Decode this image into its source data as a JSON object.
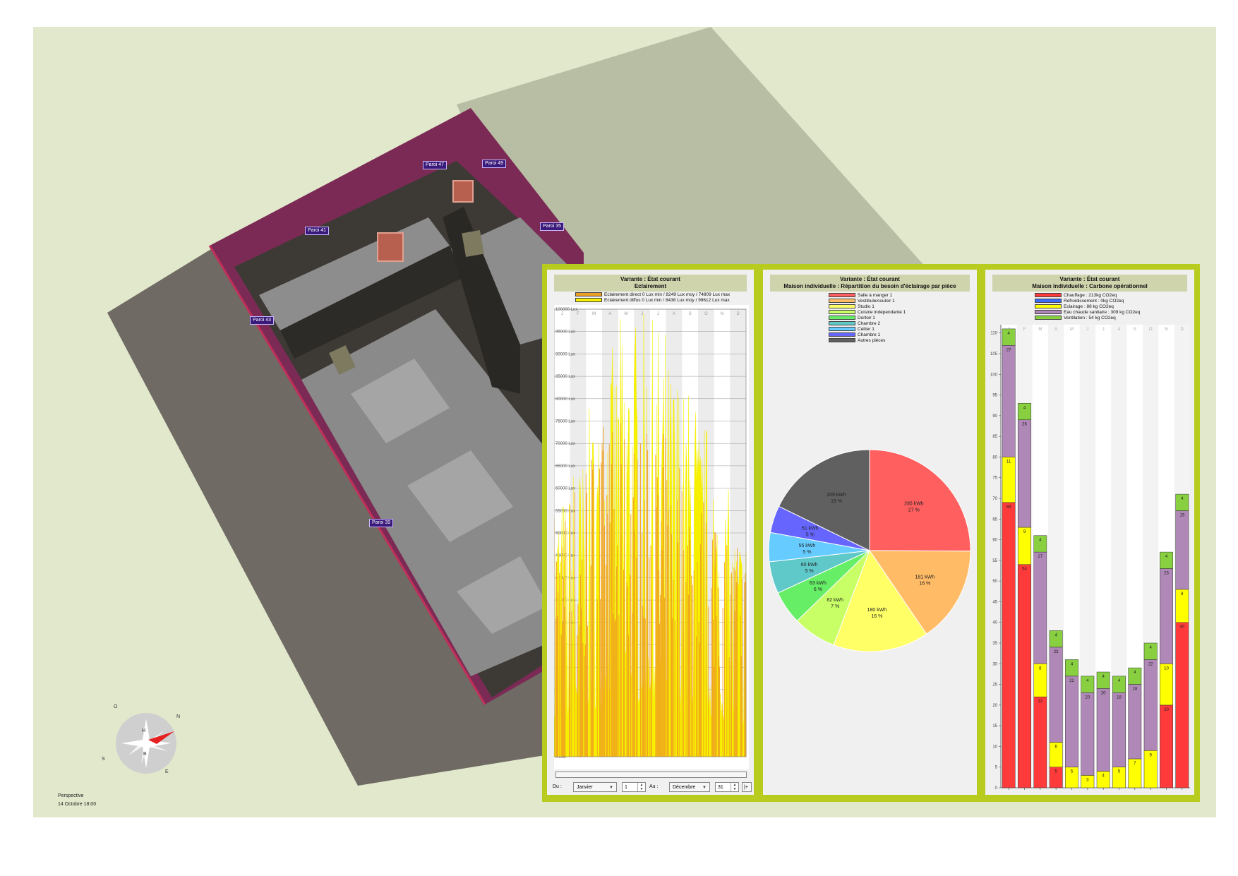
{
  "viewport": {
    "view_mode": "Perspective",
    "datetime": "14 Octobre 18:00",
    "wall_tags": [
      "Paroi 41",
      "Paroi 47",
      "Paroi 49",
      "Paroi 35",
      "Paroi 43",
      "Paroi 39"
    ],
    "compass": {
      "n": "N",
      "s": "S",
      "e": "E",
      "o": "O",
      "h": "H",
      "b": "B"
    }
  },
  "colors": {
    "frame": "#b7cc1f",
    "panel_bg": "#f0f0f0",
    "head_bg": "#cfd4ad",
    "scene_bg": "#e2e8cc"
  },
  "lighting_panel": {
    "title": "Variante : État courant",
    "subtitle": "Eclairement",
    "controls": {
      "from_label": "Du :",
      "from_month": "Janvier",
      "from_day": "1",
      "to_label": "Au :",
      "to_month": "Décembre",
      "to_day": "31"
    }
  },
  "pie_panel": {
    "title": "Variante : État courant",
    "subtitle": "Maison individuelle : Répartition du besoin d'éclairage par pièce"
  },
  "carbon_panel": {
    "title": "Variante : État courant",
    "subtitle": "Maison individuelle : Carbone opérationnel"
  },
  "chart_data": [
    {
      "type": "area",
      "title": "Eclairement",
      "series": [
        {
          "name": "Eclairement direct 0 Lux min / 8249 Lux moy / 74809 Lux max",
          "color": "#f0a020"
        },
        {
          "name": "Eclairement diffus 0 Lux min / 8438 Lux moy / 99612 Lux max",
          "color": "#f6f000"
        }
      ],
      "categories": [
        "J",
        "F",
        "M",
        "A",
        "M",
        "J",
        "J",
        "A",
        "S",
        "O",
        "N",
        "D"
      ],
      "y_ticks": [
        "0 Lux",
        "5000 Lux",
        "10000 Lux",
        "15000 Lux",
        "20000 Lux",
        "25000 Lux",
        "30000 Lux",
        "35000 Lux",
        "40000 Lux",
        "45000 Lux",
        "50000 Lux",
        "55000 Lux",
        "60000 Lux",
        "65000 Lux",
        "70000 Lux",
        "75000 Lux",
        "80000 Lux",
        "85000 Lux",
        "90000 Lux",
        "95000 Lux",
        "100000 Lux"
      ],
      "ylim": [
        0,
        100000
      ],
      "monthly_direct_peak": [
        58000,
        64000,
        72000,
        76000,
        75000,
        74000,
        73000,
        70000,
        66000,
        60000,
        52000,
        48000
      ],
      "monthly_diffuse_peak": [
        60000,
        68000,
        78000,
        92000,
        99000,
        99612,
        98000,
        90000,
        84000,
        76000,
        60000,
        52000
      ],
      "monthly_diffuse_base": [
        6000,
        8000,
        10000,
        12000,
        12000,
        11000,
        11000,
        10000,
        9000,
        8000,
        7000,
        6000
      ],
      "grid": true
    },
    {
      "type": "pie",
      "title": "Maison individuelle : Répartition du besoin d'éclairage par pièce",
      "legend": [
        "Salle à manger 1",
        "Vestibule/couloir 1",
        "Studio 1",
        "Cuisine indépendante 1",
        "Dortoir 1",
        "Chambre 2",
        "Cellier 1",
        "Chambre 1",
        "Autres pièces"
      ],
      "slices": [
        {
          "label": "295 kWh",
          "percent": "27 %",
          "value": 295,
          "color": "#ff5f5f"
        },
        {
          "label": "181 kWh",
          "percent": "16 %",
          "value": 181,
          "color": "#ffbb66"
        },
        {
          "label": "180 kWh",
          "percent": "16 %",
          "value": 180,
          "color": "#ffff66"
        },
        {
          "label": "82 kWh",
          "percent": "7 %",
          "value": 82,
          "color": "#c8ff66"
        },
        {
          "label": "63 kWh",
          "percent": "6 %",
          "value": 63,
          "color": "#66ee66"
        },
        {
          "label": "60 kWh",
          "percent": "5 %",
          "value": 60,
          "color": "#5fc8c8"
        },
        {
          "label": "55 kWh",
          "percent": "5 %",
          "value": 55,
          "color": "#66ccff"
        },
        {
          "label": "51 kWh",
          "percent": "5 %",
          "value": 51,
          "color": "#6666ff"
        },
        {
          "label": "209 kWh",
          "percent": "19 %",
          "value": 209,
          "color": "#606060"
        }
      ],
      "legend_placement": "top"
    },
    {
      "type": "bar",
      "stacked": true,
      "title": "Maison individuelle : Carbone opérationnel",
      "categories": [
        "J",
        "F",
        "M",
        "A",
        "M",
        "J",
        "J",
        "A",
        "S",
        "O",
        "N",
        "D"
      ],
      "series": [
        {
          "name": "Chauffage : 213kg CO2eq",
          "color": "#ff3a3a",
          "values": [
            69,
            54,
            22,
            5,
            0,
            0,
            0,
            0,
            0,
            0,
            20,
            40
          ]
        },
        {
          "name": "Refroidissement : 0kg CO2eq",
          "color": "#3a6aff",
          "values": [
            0,
            0,
            0,
            0,
            0,
            0,
            0,
            0,
            0,
            0,
            0,
            0
          ]
        },
        {
          "name": "Eclairage : 88 kg CO2eq",
          "color": "#ffff00",
          "values": [
            11,
            9,
            8,
            6,
            5,
            3,
            4,
            5,
            7,
            9,
            10,
            8
          ]
        },
        {
          "name": "Eau chaude sanitaire : 309 kg CO2eq",
          "color": "#b088b8",
          "values": [
            27,
            26,
            27,
            23,
            22,
            20,
            20,
            18,
            18,
            22,
            23,
            19
          ]
        },
        {
          "name": "Ventilation : 54 kg CO2eq",
          "color": "#88d040",
          "values": [
            4,
            4,
            4,
            4,
            4,
            4,
            4,
            4,
            4,
            4,
            4,
            4
          ]
        }
      ],
      "labels": {
        "chauffage": [
          "69",
          "54",
          "22",
          "5",
          "",
          "",
          "",
          "",
          "",
          "",
          "20",
          "40"
        ],
        "eclairage": [
          "11",
          "9",
          "8",
          "6",
          "5",
          "3",
          "4",
          "5",
          "7",
          "9",
          "10",
          "8"
        ],
        "eau": [
          "27",
          "26",
          "27",
          "23",
          "22",
          "20",
          "20",
          "18",
          "18",
          "22",
          "23",
          "19"
        ],
        "ventilation": [
          "4",
          "4",
          "4",
          "4",
          "4",
          "4",
          "4",
          "4",
          "4",
          "4",
          "4",
          "4"
        ]
      },
      "y_ticks": [
        "0",
        "5",
        "10",
        "15",
        "20",
        "25",
        "30",
        "35",
        "40",
        "45",
        "50",
        "55",
        "60",
        "65",
        "70",
        "75",
        "80",
        "85",
        "90",
        "95",
        "100",
        "105",
        "110"
      ],
      "ylim": [
        0,
        112
      ],
      "grid": false,
      "legend_placement": "top"
    }
  ]
}
